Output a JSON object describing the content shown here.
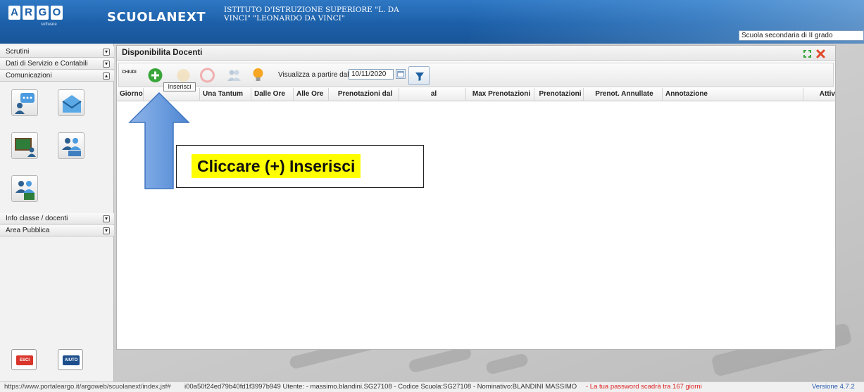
{
  "header": {
    "logo_letters": [
      "A",
      "R",
      "G",
      "O"
    ],
    "logo_sub": "software",
    "brand": "SCUOLANEXT",
    "school_name": "ISTITUTO D'ISTRUZIONE SUPERIORE \"L. DA VINCI\" \"LEONARDO DA VINCI\"",
    "school_select": "Scuola secondaria di II grado"
  },
  "sidebar": {
    "sections": [
      "Scrutini",
      "Dati di Servizio e Contabili",
      "Comunicazioni",
      "Info classe / docenti",
      "Area Pubblica"
    ],
    "toggles": [
      "▾",
      "▾",
      "▴",
      "▾",
      "▾"
    ],
    "esci_label": "ESCI",
    "aiuto_label": "AIUTO"
  },
  "panel": {
    "title": "Disponibilita Docenti",
    "chiudi": "CHIUDI",
    "date_label": "Visualizza a partire dal:",
    "date_value": "10/11/2020",
    "tooltip": "Inserisci",
    "columns": [
      "Giorno",
      "Una Tantum",
      "Dalle Ore",
      "Alle Ore",
      "Prenotazioni dal",
      "al",
      "Max Prenotazioni",
      "Prenotazioni",
      "Prenot. Annullate",
      "Annotazione",
      "Attiv"
    ]
  },
  "callout": {
    "text": "Cliccare (+) Inserisci"
  },
  "status": {
    "url": "https://www.portaleargo.it/argoweb/scuolanext/index.jsf#",
    "info": "i00a50f24ed79b40fd1f3997b949 Utente: - massimo.blandini.SG27108 - Codice Scuola:SG27108 - Nominativo:BLANDINI MASSIMO",
    "warning": "- La tua password scadrà tra 167 giorni",
    "version": "Versione 4.7.2"
  },
  "colors": {
    "header_blue": "#1c5fa8",
    "add_green": "#3aa63a",
    "highlight": "#ffff00",
    "warning_red": "#d22222"
  }
}
